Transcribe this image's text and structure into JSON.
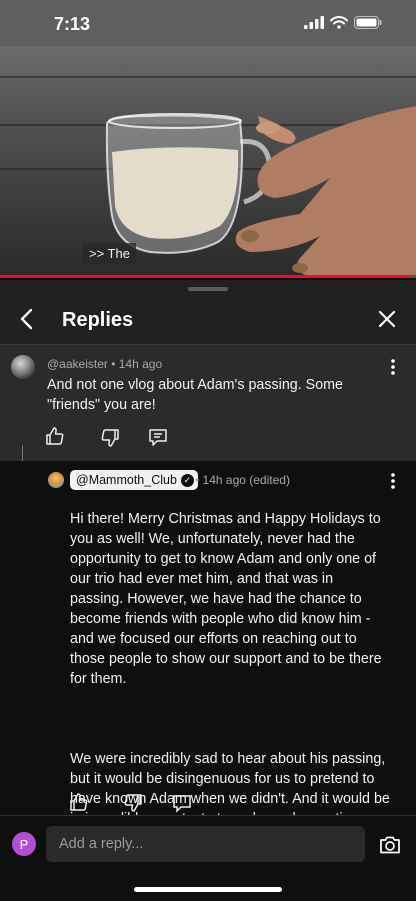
{
  "status_bar": {
    "time": "7:13"
  },
  "video": {
    "caption": ">> The",
    "progress_fraction": 0.985
  },
  "header": {
    "title": "Replies"
  },
  "parent_comment": {
    "author": "@aakeister",
    "time": "• 14h ago",
    "text": "And not one vlog about Adam's passing. Some \"friends\" you are!"
  },
  "reply": {
    "author": "@Mammoth_Club",
    "time": "• 14h ago (edited)",
    "paragraph1": "Hi there! Merry Christmas and Happy Holidays to you as well! We, unfortunately, never had the opportunity to get to know Adam and only one of our trio had ever met him, and that was in passing. However, we have had the chance to become friends with people who did know him - and we focused our efforts on reaching out to those people to show our support and to be there for them.",
    "paragraph2": "We were incredibly sad to hear about his passing, but it would be disingenuous for us to pretend to have known Adam when we didn't. And it would be in incredibly poor taste to make and monetize content about it when we didn't personally know him."
  },
  "composer": {
    "avatar_initial": "P",
    "placeholder": "Add a reply..."
  },
  "colors": {
    "accent_red": "#ff0033",
    "user_avatar": "#b04fd2"
  }
}
